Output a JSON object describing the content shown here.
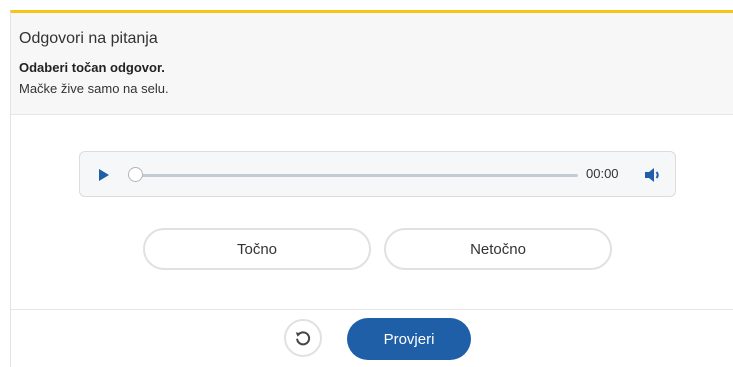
{
  "exercise": {
    "title": "Odgovori na pitanja",
    "instruction": "Odaberi točan odgovor.",
    "statement": "Mačke žive samo na selu."
  },
  "audio_player": {
    "play_icon": "play-icon",
    "time": "00:00",
    "volume_icon": "volume-icon",
    "progress": 0
  },
  "answers": {
    "true_label": "Točno",
    "false_label": "Netočno"
  },
  "footer": {
    "reset_icon": "reset-icon",
    "check_label": "Provjeri"
  },
  "colors": {
    "accent_border": "#f5c518",
    "primary_button": "#1f5fa8",
    "play_icon": "#1f5fa8"
  }
}
